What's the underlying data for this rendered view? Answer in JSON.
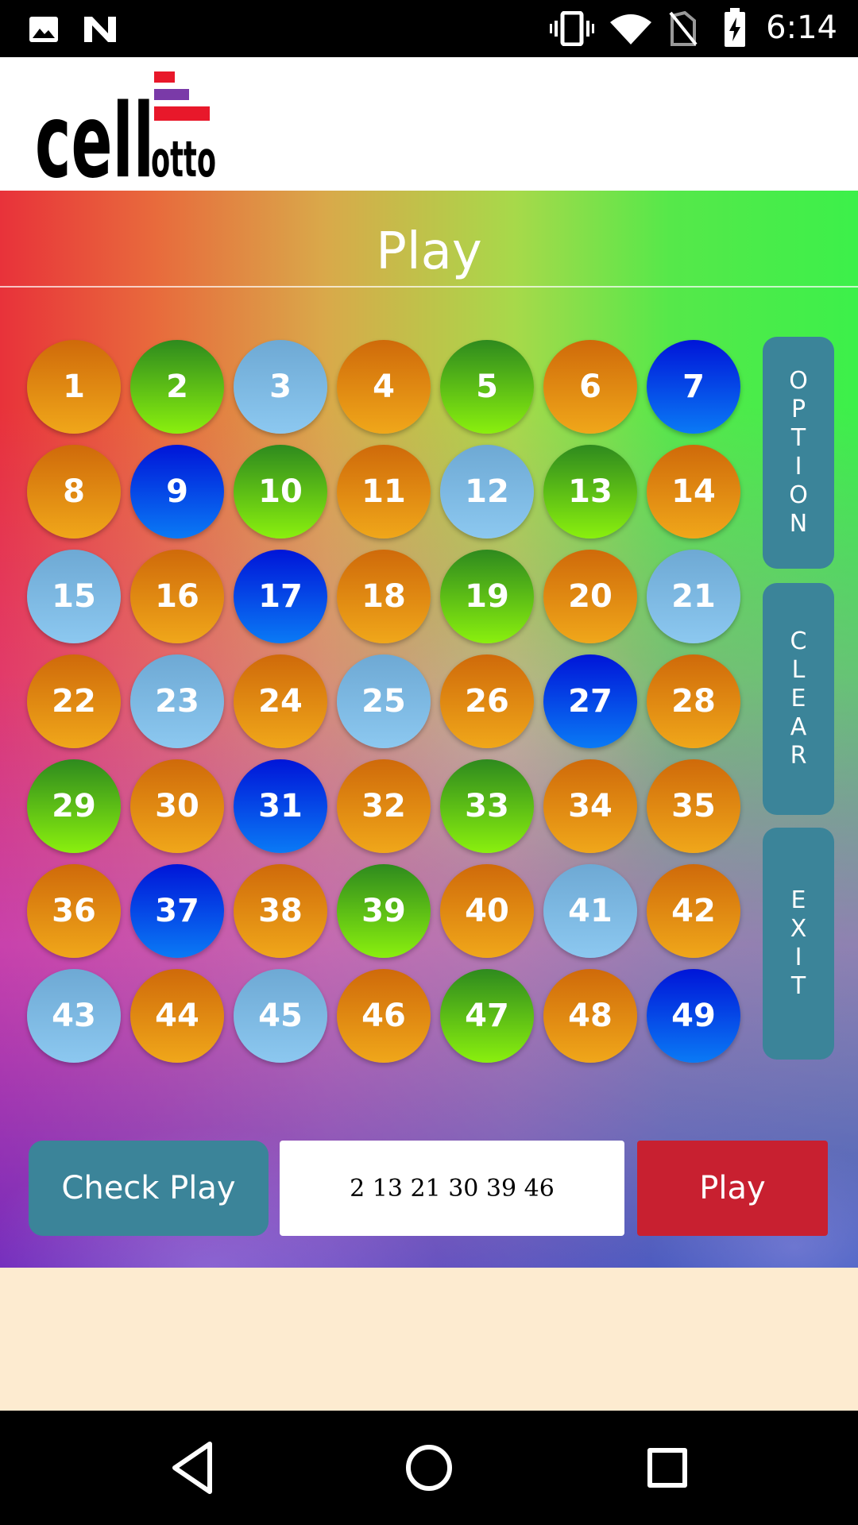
{
  "status_bar": {
    "time": "6:14",
    "icons": [
      "image-icon",
      "n-notification-icon",
      "vibrate-icon",
      "wifi-icon",
      "no-sim-icon",
      "battery-charging-icon"
    ]
  },
  "header": {
    "logo_text": "cellotto"
  },
  "screen_title": "Play",
  "balls": [
    {
      "n": "1",
      "color": "orange"
    },
    {
      "n": "2",
      "color": "green"
    },
    {
      "n": "3",
      "color": "light"
    },
    {
      "n": "4",
      "color": "orange"
    },
    {
      "n": "5",
      "color": "green"
    },
    {
      "n": "6",
      "color": "orange"
    },
    {
      "n": "7",
      "color": "blue"
    },
    {
      "n": "8",
      "color": "orange"
    },
    {
      "n": "9",
      "color": "blue"
    },
    {
      "n": "10",
      "color": "green"
    },
    {
      "n": "11",
      "color": "orange"
    },
    {
      "n": "12",
      "color": "light"
    },
    {
      "n": "13",
      "color": "green"
    },
    {
      "n": "14",
      "color": "orange"
    },
    {
      "n": "15",
      "color": "light"
    },
    {
      "n": "16",
      "color": "orange"
    },
    {
      "n": "17",
      "color": "blue"
    },
    {
      "n": "18",
      "color": "orange"
    },
    {
      "n": "19",
      "color": "green"
    },
    {
      "n": "20",
      "color": "orange"
    },
    {
      "n": "21",
      "color": "light"
    },
    {
      "n": "22",
      "color": "orange"
    },
    {
      "n": "23",
      "color": "light"
    },
    {
      "n": "24",
      "color": "orange"
    },
    {
      "n": "25",
      "color": "light"
    },
    {
      "n": "26",
      "color": "orange"
    },
    {
      "n": "27",
      "color": "blue"
    },
    {
      "n": "28",
      "color": "orange"
    },
    {
      "n": "29",
      "color": "green"
    },
    {
      "n": "30",
      "color": "orange"
    },
    {
      "n": "31",
      "color": "blue"
    },
    {
      "n": "32",
      "color": "orange"
    },
    {
      "n": "33",
      "color": "green"
    },
    {
      "n": "34",
      "color": "orange"
    },
    {
      "n": "35",
      "color": "orange"
    },
    {
      "n": "36",
      "color": "orange"
    },
    {
      "n": "37",
      "color": "blue"
    },
    {
      "n": "38",
      "color": "orange"
    },
    {
      "n": "39",
      "color": "green"
    },
    {
      "n": "40",
      "color": "orange"
    },
    {
      "n": "41",
      "color": "light"
    },
    {
      "n": "42",
      "color": "orange"
    },
    {
      "n": "43",
      "color": "light"
    },
    {
      "n": "44",
      "color": "orange"
    },
    {
      "n": "45",
      "color": "light"
    },
    {
      "n": "46",
      "color": "orange"
    },
    {
      "n": "47",
      "color": "green"
    },
    {
      "n": "48",
      "color": "orange"
    },
    {
      "n": "49",
      "color": "blue"
    }
  ],
  "side_buttons": {
    "option": "OPTION",
    "clear": "CLEAR",
    "exit": "EXIT"
  },
  "bottom": {
    "check_play_label": "Check Play",
    "selected_numbers": "2  13  21  30  39  46",
    "play_label": "Play"
  },
  "colors": {
    "ball_orange": "#e48a12",
    "ball_green": "#5cc214",
    "ball_blue": "#0a3af0",
    "ball_light": "#7fbbe4",
    "side_button": "#3b8499",
    "play_button": "#c82030",
    "ad_area": "#fdebd0"
  },
  "nav_bar": {
    "icons": [
      "back-icon",
      "home-icon",
      "recents-icon"
    ]
  }
}
